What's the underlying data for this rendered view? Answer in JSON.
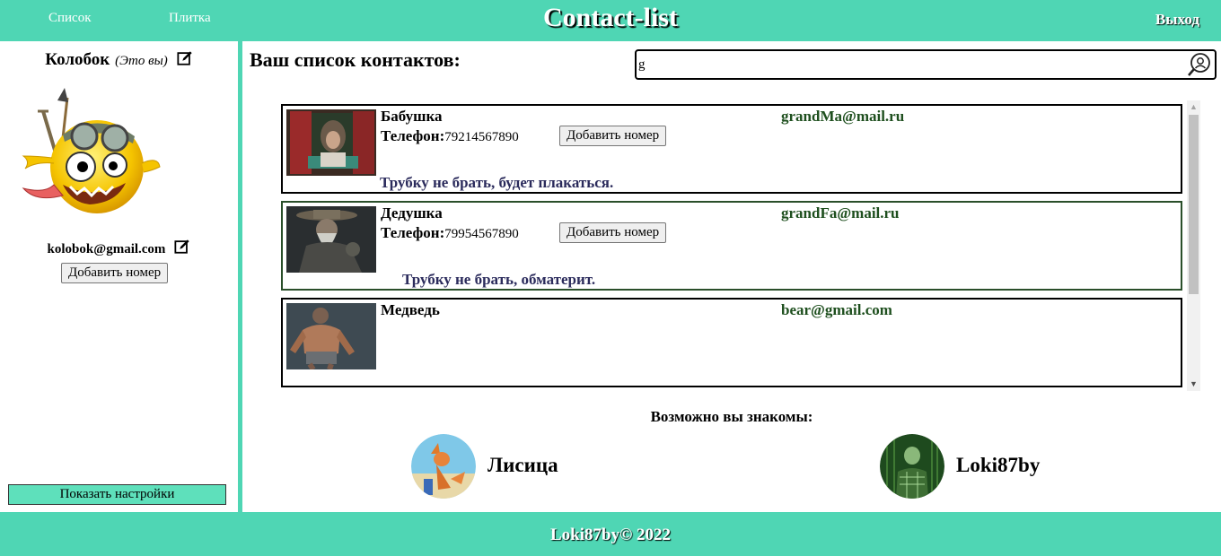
{
  "header": {
    "nav_list": "Список",
    "nav_tiles": "Плитка",
    "title": "Contact-list",
    "logout": "Выход"
  },
  "user": {
    "name": "Колобок",
    "you_label": "(Это вы)",
    "email": "kolobok@gmail.com",
    "add_phone_label": "Добавить номер",
    "settings_label": "Показать настройки"
  },
  "main": {
    "title": "Ваш список контактов:"
  },
  "search": {
    "value": "g",
    "placeholder": ""
  },
  "contacts": [
    {
      "name": "Бабушка",
      "phone_label": "Телефон:",
      "phone": "79214567890",
      "add_phone_label": "Добавить номер",
      "email": "grandMa@mail.ru",
      "note": "Трубку не брать, будет плакаться."
    },
    {
      "name": "Дедушка",
      "phone_label": "Телефон:",
      "phone": "79954567890",
      "add_phone_label": "Добавить номер",
      "email": "grandFa@mail.ru",
      "note": "Трубку не брать, обматерит."
    },
    {
      "name": "Медведь",
      "email": "bear@gmail.com"
    }
  ],
  "suggestions": {
    "title": "Возможно вы знакомы:",
    "items": [
      {
        "name": "Лисица"
      },
      {
        "name": "Loki87by"
      }
    ]
  },
  "footer": {
    "text": "Loki87by© 2022"
  },
  "colors": {
    "accent": "#4fd6b4",
    "settings_button": "#5ee0bb",
    "email_text": "#1e4f1e",
    "note_text": "#2b2b5c"
  }
}
